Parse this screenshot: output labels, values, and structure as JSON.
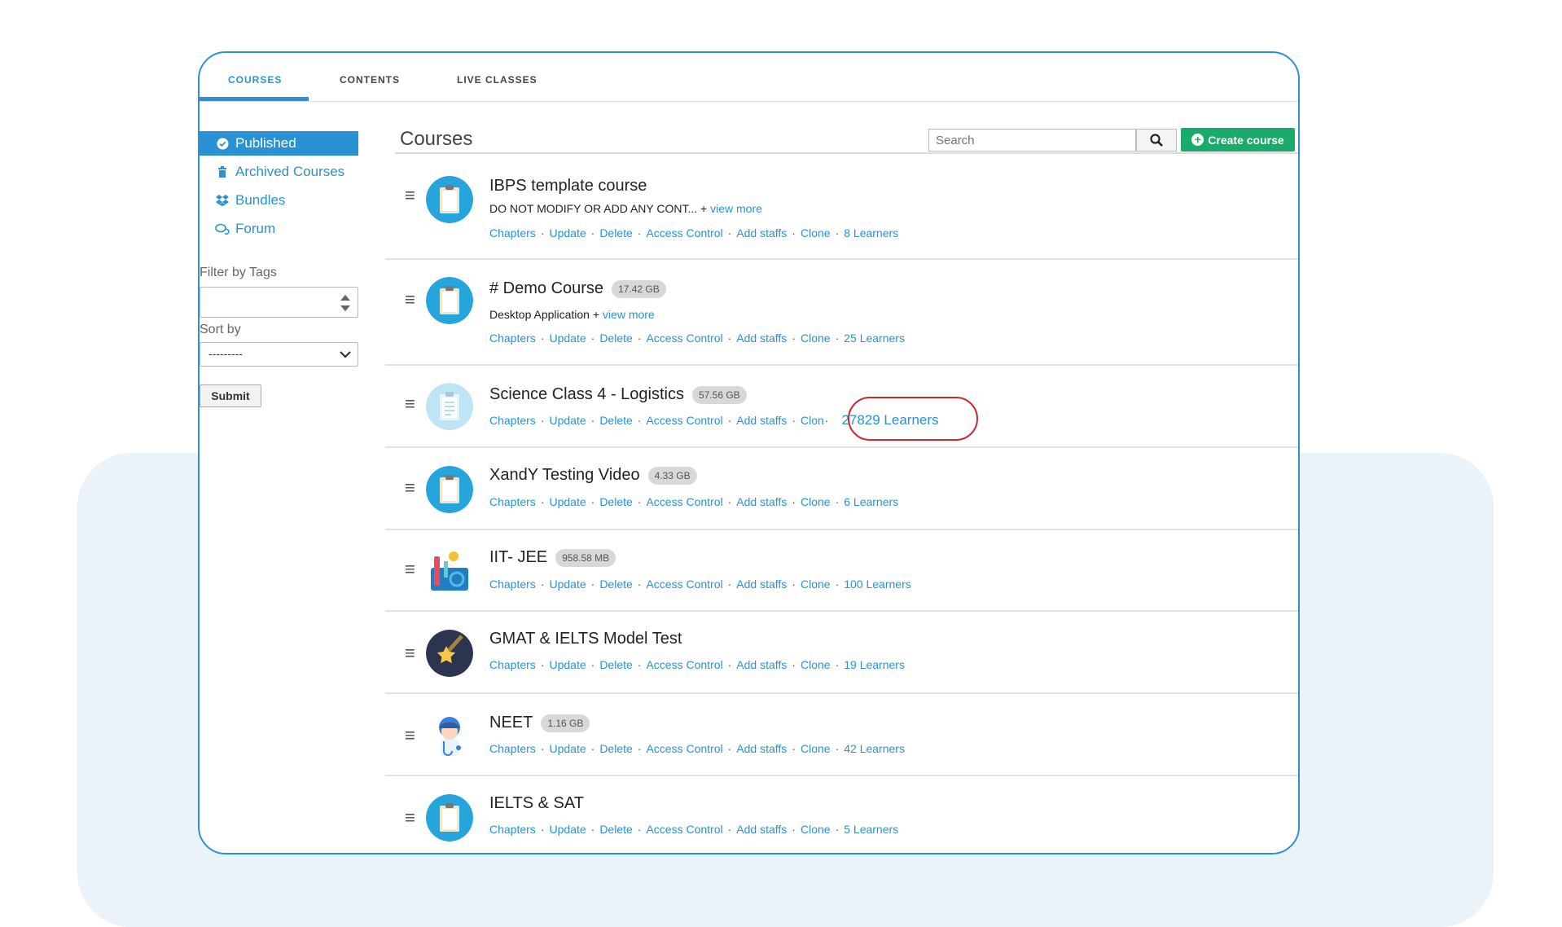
{
  "tabs": [
    {
      "label": "COURSES",
      "active": true
    },
    {
      "label": "CONTENTS",
      "active": false
    },
    {
      "label": "LIVE CLASSES",
      "active": false
    }
  ],
  "sidebar": {
    "items": [
      {
        "label": "Published",
        "icon": "check-circle-icon",
        "active": true
      },
      {
        "label": "Archived Courses",
        "icon": "trash-icon",
        "active": false
      },
      {
        "label": "Bundles",
        "icon": "dropbox-icon",
        "active": false
      },
      {
        "label": "Forum",
        "icon": "chat-icon",
        "active": false
      }
    ],
    "filter_label": "Filter by Tags",
    "sort_label": "Sort by",
    "sort_value": "---------",
    "submit_label": "Submit"
  },
  "main": {
    "title": "Courses",
    "search_placeholder": "Search",
    "create_label": "Create course"
  },
  "colors": {
    "accent": "#2a92d4",
    "create": "#1aab6b",
    "highlight": "#d0252d"
  },
  "action_labels": [
    "Chapters",
    "Update",
    "Delete",
    "Access Control",
    "Add staffs",
    "Clone"
  ],
  "courses": [
    {
      "title": "IBPS template course",
      "size": "",
      "desc": "DO NOT MODIFY OR ADD ANY CONT... + ",
      "more": "view more",
      "learners": "8 Learners",
      "avatar": "clipboard"
    },
    {
      "title": "# Demo Course",
      "size": "17.42 GB",
      "desc": "Desktop Application + ",
      "more": "view more",
      "learners": "25 Learners",
      "avatar": "clipboard"
    },
    {
      "title": "Science Class 4 - Logistics",
      "size": "57.56 GB",
      "desc": "",
      "more": "",
      "learners": "27829 Learners",
      "avatar": "clipboard-light",
      "clone_label": "Clon"
    },
    {
      "title": "XandY Testing Video",
      "size": "4.33 GB",
      "desc": "",
      "more": "",
      "learners": "6 Learners",
      "avatar": "clipboard"
    },
    {
      "title": "IIT- JEE",
      "size": "958.58 MB",
      "desc": "",
      "more": "",
      "learners": "100 Learners",
      "avatar": "science"
    },
    {
      "title": "GMAT & IELTS Model Test",
      "size": "",
      "desc": "",
      "more": "",
      "learners": "19 Learners",
      "avatar": "star"
    },
    {
      "title": "NEET",
      "size": "1.16 GB",
      "desc": "",
      "more": "",
      "learners": "42 Learners",
      "avatar": "doctor"
    },
    {
      "title": "IELTS & SAT",
      "size": "",
      "desc": "",
      "more": "",
      "learners": "5 Learners",
      "avatar": "clipboard"
    }
  ]
}
